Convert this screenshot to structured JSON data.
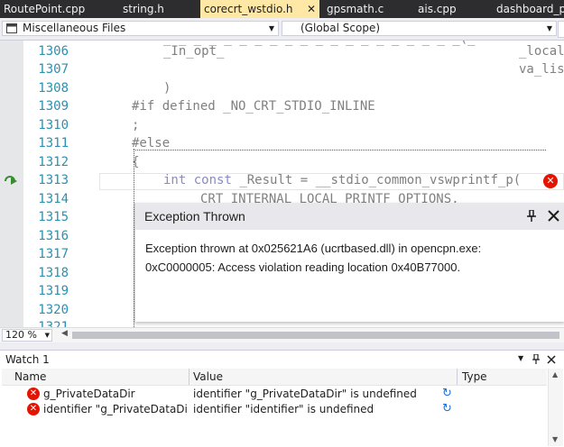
{
  "tabs": [
    {
      "label": "RoutePoint.cpp"
    },
    {
      "label": "string.h"
    },
    {
      "label": "corecrt_wstdio.h",
      "close": "✕"
    },
    {
      "label": "gpsmath.c"
    },
    {
      "label": "ais.cpp"
    },
    {
      "label": "dashboard_pi."
    }
  ],
  "nav": {
    "project": "Miscellaneous Files",
    "scope": "(Global Scope)"
  },
  "editor": {
    "line_numbers": [
      "1306",
      "1307",
      "1308",
      "1309",
      "1310",
      "1311",
      "1312",
      "1313",
      "1314",
      "1315",
      "1316",
      "1317",
      "1318",
      "1319",
      "1320",
      "1321"
    ],
    "lines": [
      "_In_opt_",
      ")",
      "#if defined _NO_CRT_STDIO_INLINE",
      ";",
      "#else",
      "{",
      "CRT_INTERNAL_LOCAL_PRINTF_OPTIONS,"
    ],
    "top_partial": "_ _ _ _ _ _ _ _ _ _ _ _ _ _ _ _ _ _ _ _(_",
    "right_1": "_local",
    "right_2": "va_lis",
    "current_line": {
      "kw_int": "int",
      "kw_const": "const",
      "rest": "_Result = __stdio_common_vswprintf_p("
    }
  },
  "exception": {
    "title": "Exception Thrown",
    "line1": "Exception thrown at 0x025621A6 (ucrtbased.dll) in opencpn.exe:",
    "line2": "0xC0000005: Access violation reading location 0x40B77000."
  },
  "zoom": "120 %",
  "watch": {
    "title": "Watch 1",
    "columns": [
      "Name",
      "Value",
      "Type"
    ],
    "rows": [
      {
        "name": "g_PrivateDataDir",
        "value": "identifier \"g_PrivateDataDir\" is undefined",
        "type": ""
      },
      {
        "name": "identifier \"g_PrivateDataDir\" ...",
        "value": "identifier \"identifier\" is undefined",
        "type": ""
      }
    ]
  },
  "colors": {
    "tab_bar": "#2d2d30",
    "active_tab": "#ffe8a6",
    "line_number": "#2b91af",
    "keyword": "#8a8ac9",
    "error": "#e51400"
  }
}
